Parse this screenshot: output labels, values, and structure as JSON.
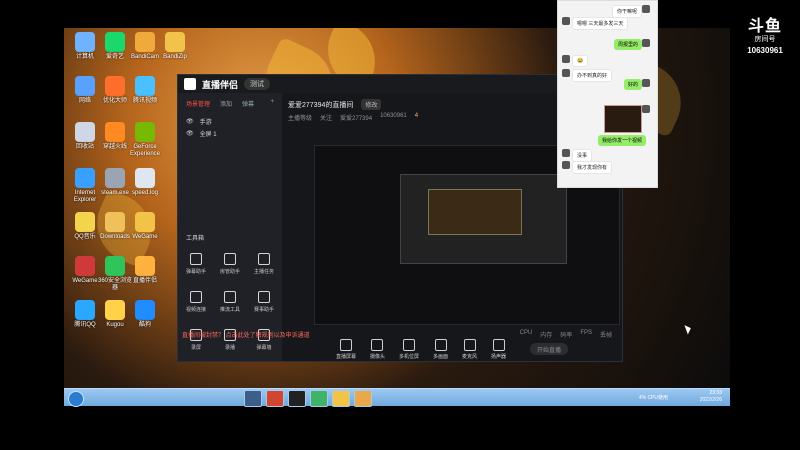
{
  "watermark": {
    "logo_text": "斗鱼",
    "sub": "房间号",
    "room": "10630961"
  },
  "desktop": {
    "icons": [
      {
        "label": "计算机",
        "color": "#6fb3ff"
      },
      {
        "label": "爱奇艺",
        "color": "#1bd86a"
      },
      {
        "label": "BandiCam",
        "color": "#f0a93b"
      },
      {
        "label": "BandiZip",
        "color": "#f1c34a"
      },
      {
        "label": "网络",
        "color": "#5aa0ff"
      },
      {
        "label": "优化大师",
        "color": "#ff6e2b"
      },
      {
        "label": "腾讯视频",
        "color": "#4bc0ff"
      },
      {
        "label": "回收站",
        "color": "#cfd7e6"
      },
      {
        "label": "穿越火线",
        "color": "#ff8a22"
      },
      {
        "label": "GeForce Experience",
        "color": "#76b900"
      },
      {
        "label": "Internet Explorer",
        "color": "#3aa0ff"
      },
      {
        "label": "steam.exe",
        "color": "#9aa4b2"
      },
      {
        "label": "speed.log",
        "color": "#dfe6ef"
      },
      {
        "label": "QQ音乐",
        "color": "#f4d34d"
      },
      {
        "label": "Downloads",
        "color": "#f0c15b"
      },
      {
        "label": "WeGame",
        "color": "#f2c346"
      },
      {
        "label": "WeGame",
        "color": "#d03939"
      },
      {
        "label": "360安全浏览器",
        "color": "#2fc55b"
      },
      {
        "label": "直播伴侣",
        "color": "#ffb23d"
      },
      {
        "label": "腾讯QQ",
        "color": "#2aa8ff"
      },
      {
        "label": "Kugou",
        "color": "#ffd24a"
      },
      {
        "label": "酷狗",
        "color": "#1f8cff"
      }
    ]
  },
  "app": {
    "brand": "直播伴侣",
    "version": "测试",
    "tabs": [
      {
        "label": "场景管理",
        "active": true
      },
      {
        "label": "添加",
        "active": false
      },
      {
        "label": "弹幕",
        "active": false
      }
    ],
    "scenes": [
      {
        "label": "手游"
      },
      {
        "label": "全屏 1"
      }
    ],
    "tools_title": "工具箱",
    "tools": [
      {
        "label": "弹幕助手"
      },
      {
        "label": "房管助手"
      },
      {
        "label": "主播任务"
      },
      {
        "label": "视频连接"
      },
      {
        "label": "推流工具"
      },
      {
        "label": "赛事助手"
      },
      {
        "label": "录屏"
      },
      {
        "label": "录播"
      },
      {
        "label": "弹幕墙"
      }
    ],
    "room": {
      "title": "爱爱277394的直播间",
      "tag": "修改",
      "sub": [
        "主播等级",
        "关注",
        "爱爱277394",
        "10630961"
      ],
      "live": "4"
    },
    "bottom": {
      "buttons": [
        "直播屏幕",
        "摄像头",
        "多机位屏",
        "多画面",
        "麦克风",
        "扬声器"
      ],
      "start": "开始直播"
    },
    "notice": "直播间被封禁？ 点击此处了解规则以及申诉通道",
    "stats": [
      "CPU",
      "内存",
      "码率",
      "FPS",
      "丢帧"
    ]
  },
  "chat": {
    "messages": [
      {
        "text": "你干嘛呢",
        "side": "right",
        "color": "white"
      },
      {
        "text": "嗯嗯 三天最多发三天",
        "side": "left",
        "color": "white"
      },
      {
        "text": "周报里的",
        "side": "right",
        "color": "green"
      },
      {
        "text": "😂",
        "side": "left",
        "color": "white"
      },
      {
        "text": "办不到真的好",
        "side": "left",
        "color": "white"
      },
      {
        "text": "好的",
        "side": "right",
        "color": "green"
      },
      {
        "text": "我给你发一个视频",
        "side": "right",
        "color": "green"
      },
      {
        "text": "没事",
        "side": "left",
        "color": "white"
      },
      {
        "text": "我才发现你有",
        "side": "left",
        "color": "white"
      }
    ]
  },
  "taskbar": {
    "cpu": "4%",
    "cpu_label": "CPU使用",
    "time": "23:33",
    "date": "2022/2/26"
  }
}
